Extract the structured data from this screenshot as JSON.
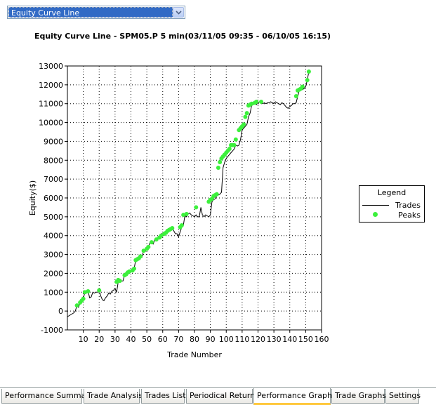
{
  "selector": {
    "value": "Equity Curve Line"
  },
  "colors": {
    "peaks": "#3cf03c",
    "line": "#000000",
    "active_tab": "#ffc83c"
  },
  "tabs": [
    {
      "label": "Performance Summary",
      "active": false
    },
    {
      "label": "Trade Analysis",
      "active": false
    },
    {
      "label": "Trades List",
      "active": false
    },
    {
      "label": "Periodical Returns",
      "active": false
    },
    {
      "label": "Performance Graphs",
      "active": true
    },
    {
      "label": "Trade Graphs",
      "active": false
    },
    {
      "label": "Settings",
      "active": false
    }
  ],
  "chart_data": {
    "type": "line",
    "title": "Equity Curve Line - SPM05.P 5 min(03/11/05 09:35 - 06/10/05 16:15)",
    "xlabel": "Trade Number",
    "ylabel": "Equity($)",
    "xlim": [
      0,
      160
    ],
    "ylim": [
      -1000,
      13000
    ],
    "xticks": [
      10,
      20,
      30,
      40,
      50,
      60,
      70,
      80,
      90,
      100,
      110,
      120,
      130,
      140,
      150,
      160
    ],
    "yticks": [
      -1000,
      0,
      1000,
      2000,
      3000,
      4000,
      5000,
      6000,
      7000,
      8000,
      9000,
      10000,
      11000,
      12000,
      13000
    ],
    "grid": true,
    "legend": {
      "title": "Legend",
      "placement": "right",
      "entries": [
        "Trades",
        "Peaks"
      ]
    },
    "series": [
      {
        "name": "Trades",
        "x": [
          0,
          2,
          4,
          5,
          6,
          7,
          8,
          9,
          10,
          11,
          12,
          13,
          14,
          15,
          16,
          17,
          18,
          19,
          20,
          21,
          22,
          23,
          24,
          25,
          26,
          27,
          28,
          29,
          30,
          31,
          32,
          33,
          34,
          35,
          36,
          37,
          38,
          39,
          40,
          41,
          42,
          43,
          44,
          45,
          46,
          47,
          48,
          49,
          50,
          51,
          52,
          53,
          54,
          55,
          56,
          57,
          58,
          59,
          60,
          61,
          62,
          63,
          64,
          65,
          66,
          67,
          68,
          69,
          70,
          71,
          72,
          73,
          74,
          75,
          76,
          77,
          78,
          79,
          80,
          81,
          82,
          83,
          84,
          85,
          86,
          87,
          88,
          89,
          90,
          91,
          92,
          93,
          94,
          95,
          96,
          97,
          98,
          99,
          100,
          101,
          102,
          103,
          104,
          105,
          106,
          107,
          108,
          109,
          110,
          111,
          112,
          113,
          114,
          115,
          116,
          117,
          118,
          119,
          120,
          121,
          122,
          123,
          124,
          125,
          126,
          127,
          128,
          129,
          130,
          131,
          132,
          133,
          134,
          135,
          136,
          137,
          138,
          139,
          140,
          141,
          142,
          143,
          144,
          145,
          146,
          147,
          148,
          149,
          150,
          151,
          152,
          153
        ],
        "y": [
          -300,
          -200,
          -100,
          0,
          300,
          200,
          450,
          550,
          650,
          1000,
          950,
          1050,
          700,
          750,
          1000,
          950,
          1000,
          1000,
          1100,
          800,
          600,
          550,
          700,
          800,
          950,
          900,
          1050,
          1100,
          1200,
          1000,
          1550,
          1650,
          1600,
          1600,
          1900,
          1950,
          2050,
          2100,
          2100,
          2150,
          2250,
          2700,
          2750,
          2800,
          2900,
          2850,
          3200,
          3150,
          3300,
          3400,
          3650,
          3600,
          3550,
          3800,
          3800,
          3900,
          4000,
          4100,
          4100,
          4150,
          4250,
          4250,
          4300,
          4350,
          4400,
          4250,
          4100,
          4100,
          3950,
          4200,
          4450,
          4550,
          5100,
          5000,
          5150,
          5200,
          5100,
          5050,
          5000,
          5100,
          5000,
          5000,
          5500,
          5100,
          5000,
          5100,
          5050,
          5000,
          5100,
          5800,
          5900,
          5950,
          6100,
          6150,
          6200,
          6300,
          7600,
          7900,
          8100,
          8200,
          8300,
          8400,
          8500,
          8600,
          8800,
          8750,
          8800,
          9100,
          9600,
          9700,
          9800,
          9900,
          10300,
          10500,
          10900,
          10950,
          11000,
          10950,
          11050,
          11100,
          11050,
          11000,
          11050,
          11000,
          11050,
          11050,
          11100,
          11050,
          11000,
          11100,
          11050,
          11000,
          10950,
          11050,
          11000,
          10900,
          10800,
          10750,
          10850,
          10900,
          11000,
          11000,
          11050,
          11400,
          11700,
          11750,
          11750,
          11800,
          11900,
          12250,
          12700,
          12700
        ]
      },
      {
        "name": "Peaks",
        "x": [
          6,
          8,
          9,
          10,
          11,
          13,
          20,
          31,
          32,
          33,
          36,
          37,
          38,
          39,
          41,
          42,
          43,
          44,
          45,
          46,
          48,
          50,
          51,
          53,
          56,
          58,
          59,
          61,
          62,
          63,
          64,
          65,
          66,
          71,
          72,
          73,
          75,
          81,
          89,
          90,
          91,
          92,
          93,
          94,
          95,
          96,
          97,
          98,
          99,
          100,
          101,
          102,
          103,
          104,
          105,
          106,
          108,
          109,
          110,
          111,
          112,
          113,
          114,
          115,
          116,
          118,
          119,
          122,
          144,
          145,
          146,
          147,
          148,
          151,
          152
        ],
        "y": [
          300,
          450,
          550,
          650,
          1000,
          1050,
          1100,
          1550,
          1650,
          1600,
          1900,
          1950,
          2050,
          2100,
          2150,
          2250,
          2700,
          2750,
          2800,
          2900,
          3200,
          3300,
          3400,
          3650,
          3800,
          3900,
          4000,
          4100,
          4150,
          4250,
          4300,
          4350,
          4400,
          4450,
          4550,
          5100,
          5150,
          5500,
          5800,
          5900,
          5950,
          6100,
          6150,
          6200,
          7600,
          7900,
          8100,
          8200,
          8300,
          8400,
          8500,
          8600,
          8800,
          8800,
          8800,
          9100,
          9600,
          9700,
          9800,
          9900,
          10300,
          10500,
          10900,
          10950,
          11000,
          11050,
          11100,
          11100,
          11400,
          11700,
          11750,
          11800,
          11900,
          12250,
          12700
        ]
      }
    ]
  }
}
